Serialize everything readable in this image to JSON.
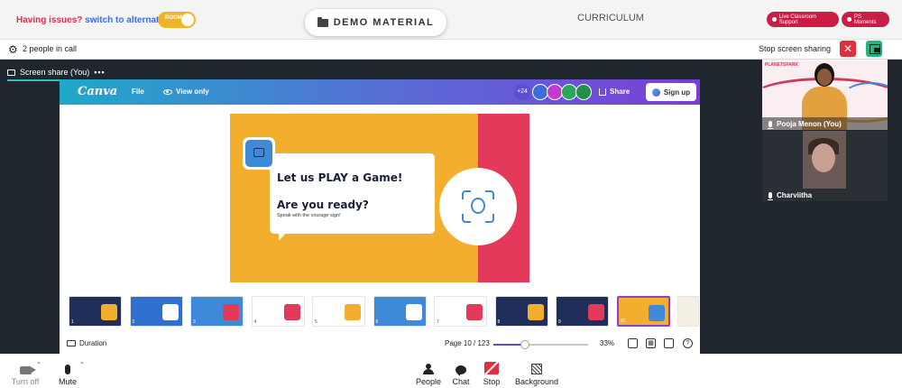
{
  "topbar": {
    "issues_text": "Having issues?",
    "switch_text": "switch to alternate room",
    "room_toggle_label": "ROOM",
    "demo_material_label": "DEMO MATERIAL",
    "curriculum_label": "CURRICULUM",
    "live_support_label": "Live Classroom Support",
    "ps_moments_label": "PS Moments"
  },
  "callbar": {
    "people_count": "2 people in call",
    "stop_sharing_label": "Stop screen sharing"
  },
  "stage": {
    "share_tab_label": "Screen share (You)",
    "more_label": "•••"
  },
  "canva": {
    "logo": "Canva",
    "file_label": "File",
    "view_only_label": "View only",
    "collaborators_more": "+24",
    "share_label": "Share",
    "signup_label": "Sign up",
    "slide": {
      "title": "Let us PLAY a Game!",
      "question": "Are you ready?",
      "subtitle": "Speak with the courage sign!"
    },
    "thumbnails": [
      {
        "num": "1",
        "bg": "#1f2f5a",
        "accent": "#f2ae2c"
      },
      {
        "num": "2",
        "bg": "#2f6fd0",
        "accent": "#ffffff"
      },
      {
        "num": "3",
        "bg": "#3f8ad8",
        "accent": "#e23a58"
      },
      {
        "num": "4",
        "bg": "#ffffff",
        "accent": "#e23a58"
      },
      {
        "num": "5",
        "bg": "#ffffff",
        "accent": "#f2ae2c"
      },
      {
        "num": "6",
        "bg": "#3f8ad8",
        "accent": "#ffffff"
      },
      {
        "num": "7",
        "bg": "#ffffff",
        "accent": "#e23a58"
      },
      {
        "num": "8",
        "bg": "#1f2f5a",
        "accent": "#f2ae2c"
      },
      {
        "num": "9",
        "bg": "#1f2f5a",
        "accent": "#e23a58"
      },
      {
        "num": "10",
        "bg": "#f2ae2c",
        "accent": "#3f8ad8"
      }
    ],
    "duration_label": "Duration",
    "page_indicator": "Page 10 / 123",
    "zoom_percent": "33%",
    "zoom_value": 0.33
  },
  "participants": [
    {
      "name": "Pooja Menon (You)",
      "brand": "PLANETSPARK"
    },
    {
      "name": "Charviitha"
    }
  ],
  "controls": {
    "camera_label": "Turn off",
    "mic_label": "Mute",
    "people_label": "People",
    "chat_label": "Chat",
    "stop_label": "Stop",
    "background_label": "Background"
  },
  "colors": {
    "accent_red": "#c81e45",
    "canva_gradient_start": "#1ea9c9",
    "canva_gradient_end": "#7a3ed6",
    "slide_orange": "#f2ae2c",
    "slide_pink": "#e23a58"
  }
}
